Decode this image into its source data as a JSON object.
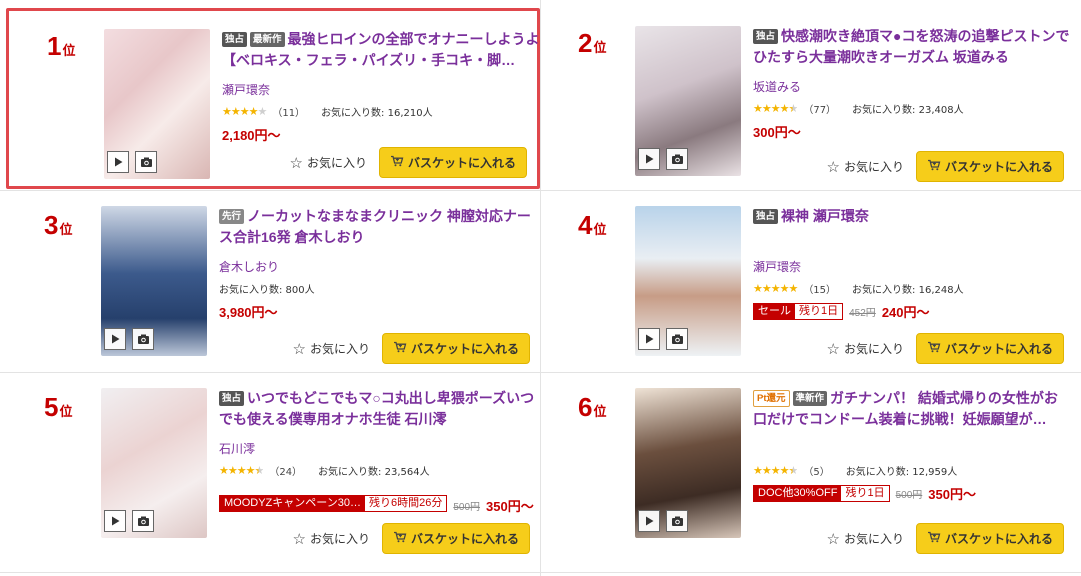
{
  "rank_suffix": "位",
  "fav_label": "お気に入り",
  "cart_label": "バスケットに入れる",
  "items": [
    {
      "rank": "1",
      "badges": [
        "独占",
        "最新作"
      ],
      "title": "最強ヒロインの全部でオナニーしようよ【ベロキス・フェラ・パイズリ・手コキ・脚…",
      "actress": "瀬戸環奈",
      "rating": 4,
      "review_count": "（11）",
      "fav_count": "お気に入り数: 16,210人",
      "price": "2,180円～"
    },
    {
      "rank": "2",
      "badges": [
        "独占"
      ],
      "title": "快感潮吹き絶頂マ●コを怒涛の追撃ピストンでひたすら大量潮吹きオーガズム 坂道みる",
      "actress": "坂道みる",
      "rating": 4.5,
      "review_count": "（77）",
      "fav_count": "お気に入り数: 23,408人",
      "price": "300円～"
    },
    {
      "rank": "3",
      "badges": [
        "先行"
      ],
      "title": "ノーカットなまなまクリニック 神膣対応ナース合計16発 倉木しおり",
      "actress": "倉木しおり",
      "rating": 0,
      "review_count": "",
      "fav_count": "お気に入り数: 800人",
      "price": "3,980円～"
    },
    {
      "rank": "4",
      "badges": [
        "独占"
      ],
      "title": "裸神 瀬戸環奈",
      "actress": "瀬戸環奈",
      "rating": 5,
      "review_count": "（15）",
      "fav_count": "お気に入り数: 16,248人",
      "sale_left": "セール",
      "sale_right": "残り1日",
      "old_price": "452円",
      "price": "240円～"
    },
    {
      "rank": "5",
      "badges": [
        "独占"
      ],
      "title": "いつでもどこでもマ○コ丸出し卑猥ポーズいつでも使える僕専用オナホ生徒 石川澪",
      "actress": "石川澪",
      "rating": 4.5,
      "review_count": "（24）",
      "fav_count": "お気に入り数: 23,564人",
      "sale_left": "MOODYZキャンペーン30…",
      "sale_right": "残り6時間26分",
      "old_price": "500円",
      "price": "350円～"
    },
    {
      "rank": "6",
      "badges": [
        "Pt還元",
        "準新作"
      ],
      "title": "ガチナンパ！ 結婚式帰りの女性がお口だけでコンドーム装着に挑戦！妊娠願望が…",
      "actress": "",
      "rating": 4.5,
      "review_count": "（5）",
      "fav_count": "お気に入り数: 12,959人",
      "sale_left": "DOC他30%OFF",
      "sale_right": "残り1日",
      "old_price": "500円",
      "price": "350円～"
    }
  ],
  "colors": {
    "rank": "#c40000",
    "title": "#7a2f9b",
    "button": "#f6cd1a",
    "highlight": "#e0474c",
    "star": "#f4b400"
  },
  "icons": {
    "play": "play-icon",
    "camera": "camera-icon",
    "fav": "star-outline-icon",
    "cart": "cart-icon"
  }
}
